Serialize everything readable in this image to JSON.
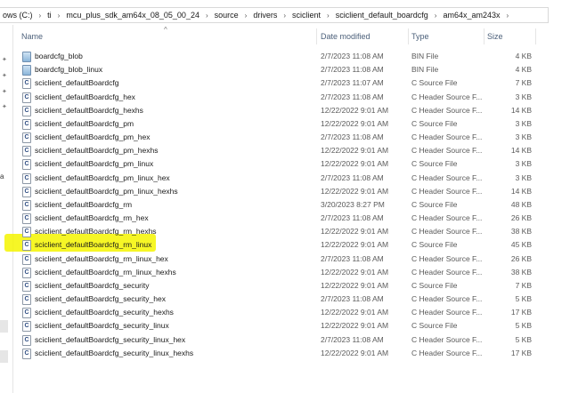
{
  "breadcrumb": [
    {
      "label": "ows (C:)"
    },
    {
      "label": "ti"
    },
    {
      "label": "mcu_plus_sdk_am64x_08_05_00_24"
    },
    {
      "label": "source"
    },
    {
      "label": "drivers"
    },
    {
      "label": "sciclient"
    },
    {
      "label": "sciclient_default_boardcfg"
    },
    {
      "label": "am64x_am243x"
    }
  ],
  "sidebar": {
    "letter": "a"
  },
  "columns": {
    "name": "Name",
    "date": "Date modified",
    "type": "Type",
    "size": "Size"
  },
  "files": [
    {
      "name": "boardcfg_blob",
      "date": "2/7/2023 11:08 AM",
      "type": "BIN File",
      "size": "4 KB",
      "icon": "bin-file-icon"
    },
    {
      "name": "boardcfg_blob_linux",
      "date": "2/7/2023 11:08 AM",
      "type": "BIN File",
      "size": "4 KB",
      "icon": "bin-file-icon"
    },
    {
      "name": "sciclient_defaultBoardcfg",
      "date": "2/7/2023 11:07 AM",
      "type": "C Source File",
      "size": "7 KB",
      "icon": "c-file-icon"
    },
    {
      "name": "sciclient_defaultBoardcfg_hex",
      "date": "2/7/2023 11:08 AM",
      "type": "C Header Source F...",
      "size": "3 KB",
      "icon": "c-file-icon"
    },
    {
      "name": "sciclient_defaultBoardcfg_hexhs",
      "date": "12/22/2022 9:01 AM",
      "type": "C Header Source F...",
      "size": "14 KB",
      "icon": "c-file-icon"
    },
    {
      "name": "sciclient_defaultBoardcfg_pm",
      "date": "12/22/2022 9:01 AM",
      "type": "C Source File",
      "size": "3 KB",
      "icon": "c-file-icon"
    },
    {
      "name": "sciclient_defaultBoardcfg_pm_hex",
      "date": "2/7/2023 11:08 AM",
      "type": "C Header Source F...",
      "size": "3 KB",
      "icon": "c-file-icon"
    },
    {
      "name": "sciclient_defaultBoardcfg_pm_hexhs",
      "date": "12/22/2022 9:01 AM",
      "type": "C Header Source F...",
      "size": "14 KB",
      "icon": "c-file-icon"
    },
    {
      "name": "sciclient_defaultBoardcfg_pm_linux",
      "date": "12/22/2022 9:01 AM",
      "type": "C Source File",
      "size": "3 KB",
      "icon": "c-file-icon"
    },
    {
      "name": "sciclient_defaultBoardcfg_pm_linux_hex",
      "date": "2/7/2023 11:08 AM",
      "type": "C Header Source F...",
      "size": "3 KB",
      "icon": "c-file-icon"
    },
    {
      "name": "sciclient_defaultBoardcfg_pm_linux_hexhs",
      "date": "12/22/2022 9:01 AM",
      "type": "C Header Source F...",
      "size": "14 KB",
      "icon": "c-file-icon"
    },
    {
      "name": "sciclient_defaultBoardcfg_rm",
      "date": "3/20/2023 8:27 PM",
      "type": "C Source File",
      "size": "48 KB",
      "icon": "c-file-icon"
    },
    {
      "name": "sciclient_defaultBoardcfg_rm_hex",
      "date": "2/7/2023 11:08 AM",
      "type": "C Header Source F...",
      "size": "26 KB",
      "icon": "c-file-icon"
    },
    {
      "name": "sciclient_defaultBoardcfg_rm_hexhs",
      "date": "12/22/2022 9:01 AM",
      "type": "C Header Source F...",
      "size": "38 KB",
      "icon": "c-file-icon"
    },
    {
      "name": "sciclient_defaultBoardcfg_rm_linux",
      "date": "12/22/2022 9:01 AM",
      "type": "C Source File",
      "size": "45 KB",
      "icon": "c-file-icon",
      "highlighted": true
    },
    {
      "name": "sciclient_defaultBoardcfg_rm_linux_hex",
      "date": "2/7/2023 11:08 AM",
      "type": "C Header Source F...",
      "size": "26 KB",
      "icon": "c-file-icon"
    },
    {
      "name": "sciclient_defaultBoardcfg_rm_linux_hexhs",
      "date": "12/22/2022 9:01 AM",
      "type": "C Header Source F...",
      "size": "38 KB",
      "icon": "c-file-icon"
    },
    {
      "name": "sciclient_defaultBoardcfg_security",
      "date": "12/22/2022 9:01 AM",
      "type": "C Source File",
      "size": "7 KB",
      "icon": "c-file-icon"
    },
    {
      "name": "sciclient_defaultBoardcfg_security_hex",
      "date": "2/7/2023 11:08 AM",
      "type": "C Header Source F...",
      "size": "5 KB",
      "icon": "c-file-icon"
    },
    {
      "name": "sciclient_defaultBoardcfg_security_hexhs",
      "date": "12/22/2022 9:01 AM",
      "type": "C Header Source F...",
      "size": "17 KB",
      "icon": "c-file-icon"
    },
    {
      "name": "sciclient_defaultBoardcfg_security_linux",
      "date": "12/22/2022 9:01 AM",
      "type": "C Source File",
      "size": "5 KB",
      "icon": "c-file-icon"
    },
    {
      "name": "sciclient_defaultBoardcfg_security_linux_hex",
      "date": "2/7/2023 11:08 AM",
      "type": "C Header Source F...",
      "size": "5 KB",
      "icon": "c-file-icon"
    },
    {
      "name": "sciclient_defaultBoardcfg_security_linux_hexhs",
      "date": "12/22/2022 9:01 AM",
      "type": "C Header Source F...",
      "size": "17 KB",
      "icon": "c-file-icon"
    }
  ],
  "colors": {
    "highlight": "#f5f500",
    "header_text": "#4c607a"
  }
}
